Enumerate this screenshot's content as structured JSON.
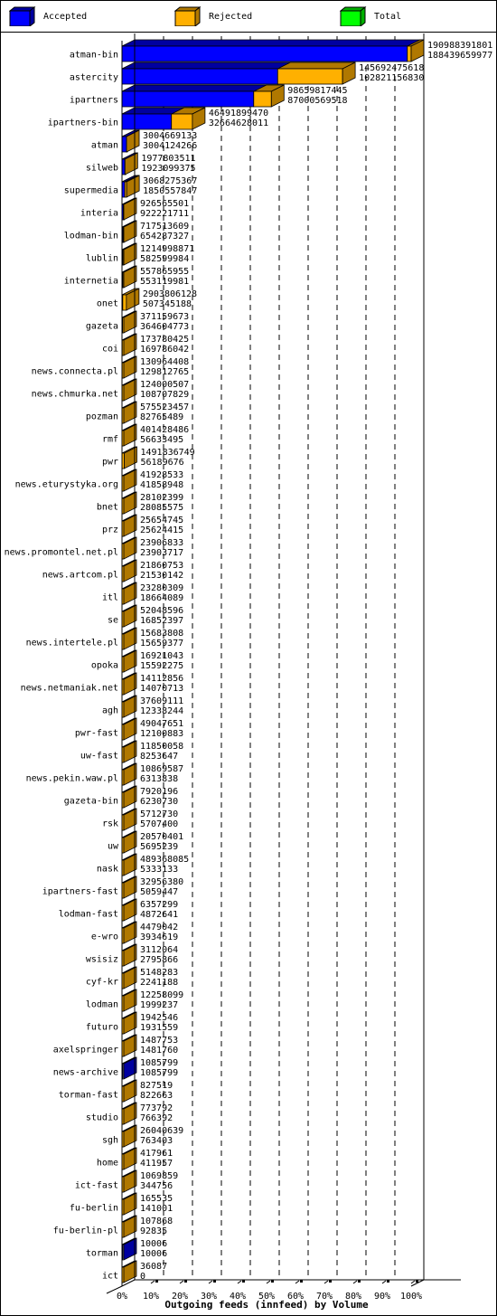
{
  "legend": [
    {
      "label": "Accepted",
      "color": "#0000ff",
      "side": "#0000a0"
    },
    {
      "label": "Rejected",
      "color": "#ffb000",
      "side": "#b07800"
    },
    {
      "label": "Total",
      "color": "#00ff00",
      "side": "#00b000"
    }
  ],
  "chart_data": {
    "type": "bar",
    "orientation": "horizontal",
    "title": "Outgoing feeds (innfeed) by Volume",
    "xlabel": "Outgoing feeds (innfeed) by Volume",
    "ylabel": "",
    "xlim": [
      0,
      100
    ],
    "x_ticks": [
      "0%",
      "10%",
      "20%",
      "30%",
      "40%",
      "50%",
      "60%",
      "70%",
      "80%",
      "90%",
      "100%"
    ],
    "grid": "vertical dashed",
    "legend_position": "top",
    "categories": [
      "atman-bin",
      "astercity",
      "ipartners",
      "ipartners-bin",
      "atman",
      "silweb",
      "supermedia",
      "interia",
      "lodman-bin",
      "lublin",
      "internetia",
      "onet",
      "gazeta",
      "coi",
      "news.connecta.pl",
      "news.chmurka.net",
      "pozman",
      "rmf",
      "pwr",
      "news.eturystyka.org",
      "bnet",
      "prz",
      "news.promontel.net.pl",
      "news.artcom.pl",
      "itl",
      "se",
      "news.intertele.pl",
      "opoka",
      "news.netmaniak.net",
      "agh",
      "pwr-fast",
      "uw-fast",
      "news.pekin.waw.pl",
      "gazeta-bin",
      "rsk",
      "uw",
      "nask",
      "ipartners-fast",
      "lodman-fast",
      "e-wro",
      "wsisiz",
      "cyf-kr",
      "lodman",
      "futuro",
      "axelspringer",
      "news-archive",
      "torman-fast",
      "studio",
      "sgh",
      "home",
      "ict-fast",
      "fu-berlin",
      "fu-berlin-pl",
      "torman",
      "ict"
    ],
    "series": [
      {
        "name": "Total",
        "values": [
          190988391801,
          145692475618,
          98659817445,
          46491899470,
          3004669133,
          1977803511,
          3068275367,
          926565501,
          717513609,
          1214998871,
          557865955,
          2903806128,
          371159673,
          173780425,
          130964408,
          124000507,
          575523457,
          401428486,
          1491836749,
          41928533,
          28102399,
          25654745,
          23906833,
          21860753,
          23280309,
          52048596,
          15683808,
          16921043,
          14112856,
          37609111,
          49047651,
          11850058,
          10869587,
          7920196,
          5712730,
          20570401,
          489368085,
          32956380,
          6357299,
          4479042,
          3112064,
          5148283,
          12258099,
          1942546,
          1487753,
          1085799,
          827519,
          773792,
          26040639,
          417961,
          1069859,
          165535,
          107868,
          10006,
          36087
        ]
      },
      {
        "name": "Accepted",
        "values": [
          188439659977,
          102821156830,
          87000569518,
          32664628011,
          3004124266,
          1923099375,
          1850557847,
          922221711,
          654287327,
          582599984,
          553119981,
          507345188,
          364604773,
          169786042,
          129812765,
          108707829,
          82765489,
          56633495,
          56189676,
          41858948,
          28085575,
          25624415,
          23903717,
          21530142,
          18664089,
          16852397,
          15659377,
          15592275,
          14070713,
          12338244,
          12100883,
          8253647,
          6313838,
          6230730,
          5707400,
          5695239,
          5333133,
          5059447,
          4872641,
          3934619,
          2795866,
          2241188,
          1999237,
          1931559,
          1481760,
          1085799,
          822663,
          766392,
          763403,
          411957,
          344756,
          141001,
          92835,
          10006,
          0
        ]
      }
    ],
    "units": "bytes"
  }
}
